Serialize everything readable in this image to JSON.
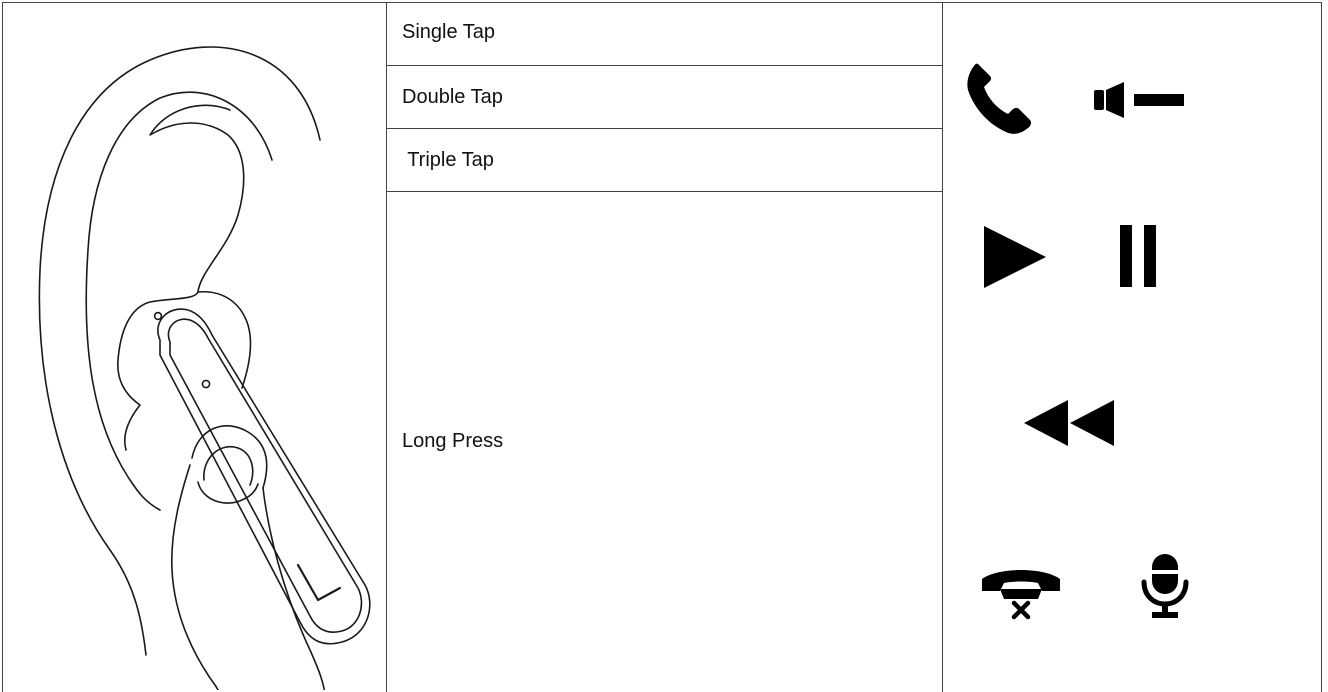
{
  "gestures": {
    "single_tap": "Single Tap",
    "double_tap": "Double Tap",
    "triple_tap": " Triple Tap",
    "long_press": "Long Press"
  },
  "earbud_marking": "L",
  "icons": {
    "row1": [
      "phone-answer-icon",
      "volume-down-icon"
    ],
    "row2": [
      "play-icon",
      "pause-icon"
    ],
    "row3": [
      "rewind-icon"
    ],
    "row4": [
      "hang-up-icon",
      "microphone-icon"
    ]
  },
  "colors": {
    "line": "#444444",
    "icon": "#000000",
    "text": "#111111"
  }
}
